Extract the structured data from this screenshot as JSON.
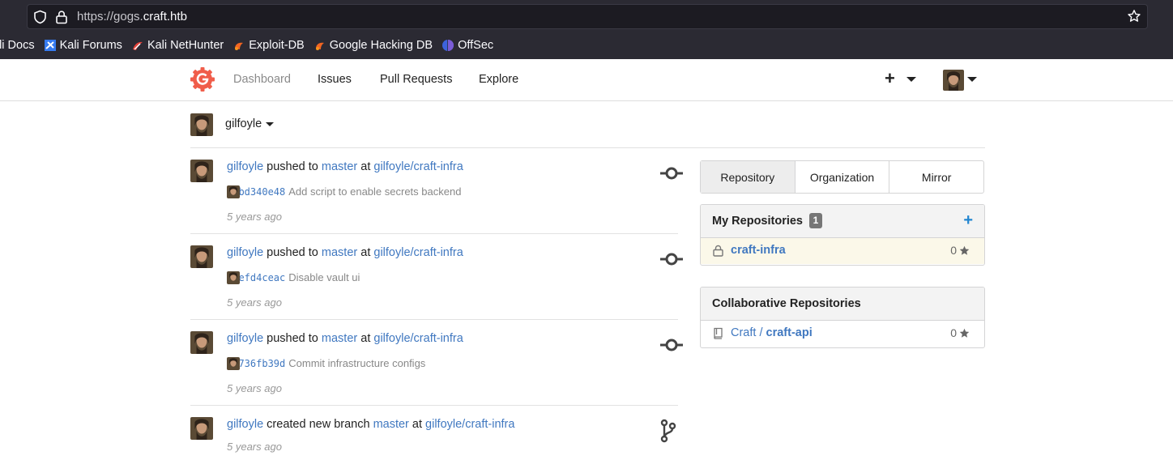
{
  "browser": {
    "url_prefix": "https://gogs.",
    "url_host": "craft.htb",
    "bookmarks": [
      {
        "label": "ali Docs",
        "icon": "kali-docs-icon"
      },
      {
        "label": "Kali Forums",
        "icon": "kali-forums-icon"
      },
      {
        "label": "Kali NetHunter",
        "icon": "kali-nethunter-icon"
      },
      {
        "label": "Exploit-DB",
        "icon": "exploit-db-icon"
      },
      {
        "label": "Google Hacking DB",
        "icon": "google-hacking-db-icon"
      },
      {
        "label": "OffSec",
        "icon": "offsec-icon"
      }
    ]
  },
  "nav": {
    "dashboard": "Dashboard",
    "issues": "Issues",
    "pull_requests": "Pull Requests",
    "explore": "Explore",
    "plus": "+"
  },
  "context": {
    "user": "gilfoyle"
  },
  "feed": [
    {
      "user": "gilfoyle",
      "action": "pushed to",
      "branch": "master",
      "at": "at",
      "repo": "gilfoyle/craft-infra",
      "sha": "72bd340e48",
      "message": "Add script to enable secrets backend",
      "time": "5 years ago",
      "icon": "commit-icon"
    },
    {
      "user": "gilfoyle",
      "action": "pushed to",
      "branch": "master",
      "at": "at",
      "repo": "gilfoyle/craft-infra",
      "sha": "a7efd4ceac",
      "message": "Disable vault ui",
      "time": "5 years ago",
      "icon": "commit-icon"
    },
    {
      "user": "gilfoyle",
      "action": "pushed to",
      "branch": "master",
      "at": "at",
      "repo": "gilfoyle/craft-infra",
      "sha": "84736fb39d",
      "message": "Commit infrastructure configs",
      "time": "5 years ago",
      "icon": "commit-icon"
    },
    {
      "user": "gilfoyle",
      "action": "created new branch",
      "branch": "master",
      "at": "at",
      "repo": "gilfoyle/craft-infra",
      "time": "5 years ago",
      "icon": "branch-icon"
    }
  ],
  "tabs": [
    "Repository",
    "Organization",
    "Mirror"
  ],
  "my_repos": {
    "title": "My Repositories",
    "count": "1",
    "items": [
      {
        "name": "craft-infra",
        "stars": "0",
        "private": true
      }
    ]
  },
  "collab_repos": {
    "title": "Collaborative Repositories",
    "items": [
      {
        "owner": "Craft",
        "sep": "/",
        "name": "craft-api",
        "stars": "0"
      }
    ]
  },
  "colors": {
    "link": "#4078c0",
    "accent": "#2185d0",
    "logo": "#f05d4a"
  }
}
